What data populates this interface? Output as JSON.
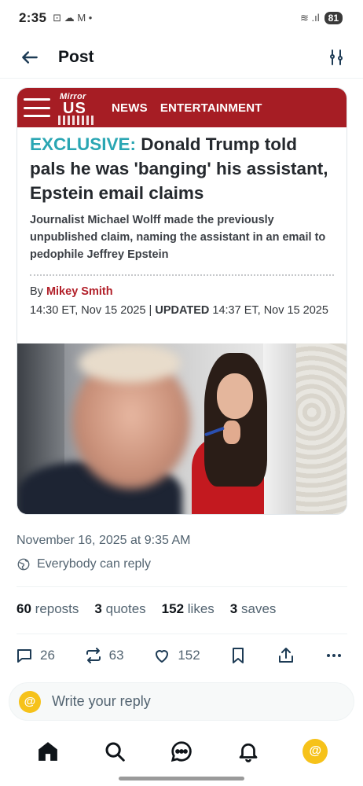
{
  "status_bar": {
    "time": "2:35",
    "notif_glyphs": "⊡ ☁ M •",
    "signal_glyphs": "≋ .ıl",
    "battery": "81"
  },
  "header": {
    "title": "Post"
  },
  "article": {
    "publisher_logo_top": "Mirror",
    "publisher_logo_bottom": "US",
    "nav": [
      "NEWS",
      "ENTERTAINMENT"
    ],
    "headline_prefix": "EXCLUSIVE:",
    "headline_rest": " Donald Trump told pals he was 'banging' his assistant, Epstein email claims",
    "subhead": "Journalist Michael Wolff made the previously unpublished claim, naming the assistant in an email to pedophile Jeffrey Epstein",
    "byline_prefix": "By ",
    "author": "Mikey Smith",
    "published": "14:30 ET, Nov 15 2025 | ",
    "updated_label": "UPDATED",
    "updated": " 14:37 ET, Nov 15 2025",
    "brand_color": "#a61d24",
    "accent_color": "#2aa6b3"
  },
  "post": {
    "timestamp": "November 16, 2025 at 9:35 AM",
    "reply_scope": "Everybody can reply",
    "stats": [
      {
        "count": "60",
        "label": "reposts"
      },
      {
        "count": "3",
        "label": "quotes"
      },
      {
        "count": "152",
        "label": "likes"
      },
      {
        "count": "3",
        "label": "saves"
      }
    ],
    "actions": {
      "replies": "26",
      "reposts": "63",
      "likes": "152"
    }
  },
  "reply": {
    "avatar_letter": "@",
    "placeholder": "Write your reply"
  },
  "bottom_nav": {
    "avatar_letter": "@"
  }
}
